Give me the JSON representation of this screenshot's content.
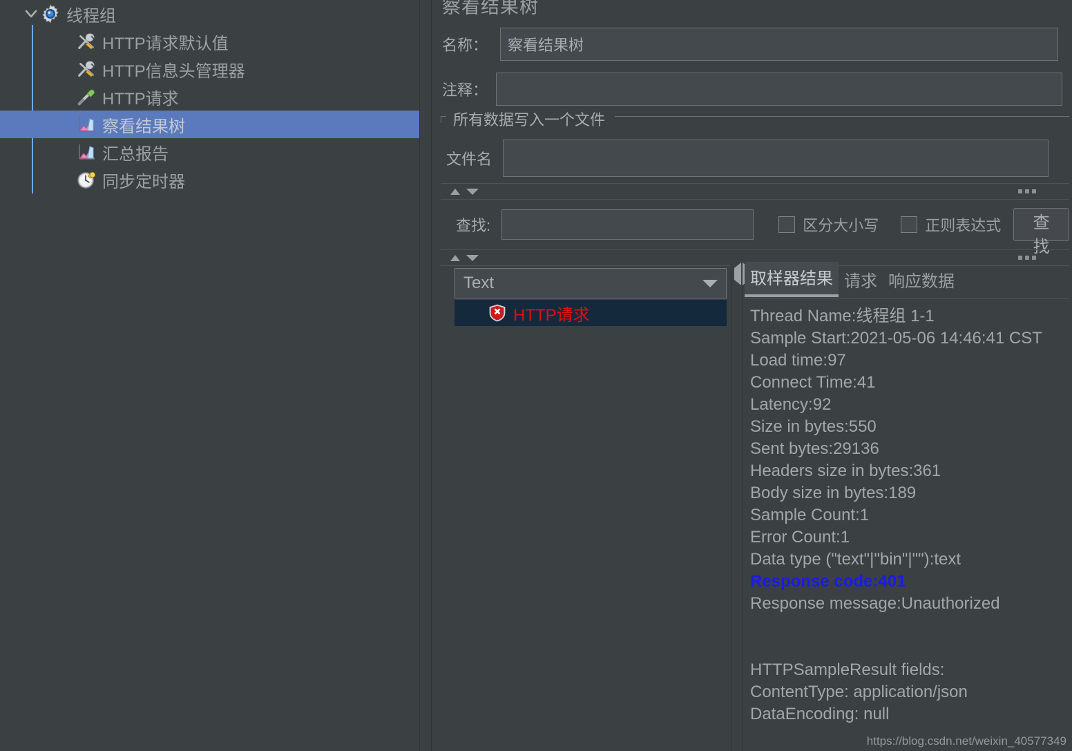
{
  "tree": {
    "root_label": "线程组",
    "root_icon": "gear-icon",
    "items": [
      {
        "label": "HTTP请求默认值",
        "icon": "tools-icon",
        "selected": false
      },
      {
        "label": "HTTP信息头管理器",
        "icon": "tools-icon",
        "selected": false
      },
      {
        "label": "HTTP请求",
        "icon": "pipette-icon",
        "selected": false
      },
      {
        "label": "察看结果树",
        "icon": "chart-icon",
        "selected": true
      },
      {
        "label": "汇总报告",
        "icon": "chart-icon",
        "selected": false
      },
      {
        "label": "同步定时器",
        "icon": "timer-icon",
        "selected": false
      }
    ]
  },
  "panel": {
    "title": "察看结果树",
    "name_label": "名称：",
    "name_value": "察看结果树",
    "comment_label": "注释：",
    "comment_value": "",
    "group_legend": "所有数据写入一个文件",
    "filename_label": "文件名",
    "filename_value": ""
  },
  "search": {
    "label": "查找:",
    "value": "",
    "case_sensitive_label": "区分大小写",
    "case_sensitive_checked": false,
    "regex_label": "正则表达式",
    "regex_checked": false,
    "find_button": "查找"
  },
  "results": {
    "renderer_selected": "Text",
    "rows": [
      {
        "label": "HTTP请求",
        "status": "error",
        "icon": "error-shield-icon",
        "selected": true
      }
    ]
  },
  "tabs": [
    {
      "label": "取样器结果",
      "active": true
    },
    {
      "label": "请求",
      "active": false
    },
    {
      "label": "响应数据",
      "active": false
    }
  ],
  "sampler_result": {
    "lines": [
      {
        "text": "Thread Name:线程组 1-1",
        "style": "normal"
      },
      {
        "text": "Sample Start:2021-05-06 14:46:41 CST",
        "style": "normal"
      },
      {
        "text": "Load time:97",
        "style": "normal"
      },
      {
        "text": "Connect Time:41",
        "style": "normal"
      },
      {
        "text": "Latency:92",
        "style": "normal"
      },
      {
        "text": "Size in bytes:550",
        "style": "normal"
      },
      {
        "text": "Sent bytes:29136",
        "style": "normal"
      },
      {
        "text": "Headers size in bytes:361",
        "style": "normal"
      },
      {
        "text": "Body size in bytes:189",
        "style": "normal"
      },
      {
        "text": "Sample Count:1",
        "style": "normal"
      },
      {
        "text": "Error Count:1",
        "style": "normal"
      },
      {
        "text": "Data type (\"text\"|\"bin\"|\"\"):text",
        "style": "normal"
      },
      {
        "text": "Response code:401",
        "style": "respcode"
      },
      {
        "text": "Response message:Unauthorized",
        "style": "normal"
      },
      {
        "text": "",
        "style": "blank"
      },
      {
        "text": "",
        "style": "blank"
      },
      {
        "text": "HTTPSampleResult fields:",
        "style": "normal"
      },
      {
        "text": "ContentType: application/json",
        "style": "normal"
      },
      {
        "text": "DataEncoding: null",
        "style": "normal"
      }
    ]
  },
  "watermark": "https://blog.csdn.net/weixin_40577349",
  "colors": {
    "background": "#3b4043",
    "tree_selection": "#5b79bd",
    "result_selection": "#15293d",
    "error_text": "#e01010",
    "response_code": "#1a1aee",
    "text": "#a2a7ac",
    "indent_guide": "#6fa8e8"
  }
}
